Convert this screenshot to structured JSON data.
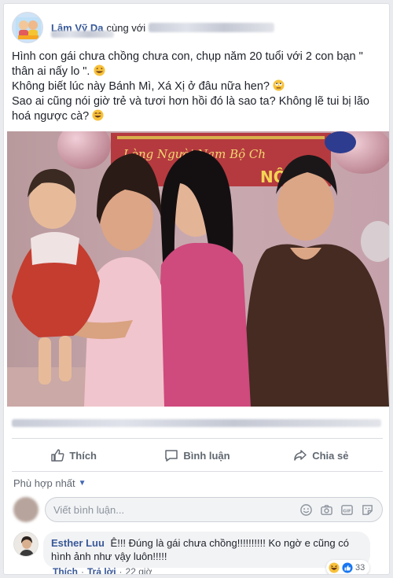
{
  "post": {
    "author": "Lâm Vỹ Dạ",
    "with_text": "cùng với",
    "text": {
      "line1": "Hình con gái chưa chồng chưa con, chụp năm 20 tuổi với 2 con bạn \" thân ai nấy lo \".",
      "line2": "Không biết lúc này Bánh Mì, Xá Xị ở đâu nữa hen?",
      "line3": "Sao ai cũng nói giờ trẻ và tươi hơn hồi đó là sao ta? Không lẽ tui bị lão hoá ngược cà?"
    },
    "photo_banner": "Lòng Người Nam Bộ Chư ... NỒI",
    "photo_banner_left": "Lòng Người Nam Bộ Ch",
    "photo_banner_right": "NÔI"
  },
  "actions": {
    "like": "Thích",
    "comment": "Bình luận",
    "share": "Chia sẻ"
  },
  "comments": {
    "sort_label": "Phù hợp nhất",
    "input_placeholder": "Viết bình luận...",
    "items": [
      {
        "author": "Esther Luu",
        "text": "Ê!!! Đúng là gái chưa chồng!!!!!!!!!! Ko ngờ e cũng có hình ảnh như vậy luôn!!!!!",
        "like": "Thích",
        "reply": "Trả lời",
        "time": "22 giờ",
        "reaction_count": "33"
      }
    ]
  },
  "colors": {
    "link_blue": "#365899",
    "accent": "#4267b2",
    "muted": "#606770"
  },
  "icons": [
    "like-icon",
    "comment-icon",
    "share-icon",
    "emoji-icon",
    "camera-icon",
    "gif-icon",
    "sticker-icon",
    "haha-reaction-icon",
    "like-reaction-icon"
  ]
}
